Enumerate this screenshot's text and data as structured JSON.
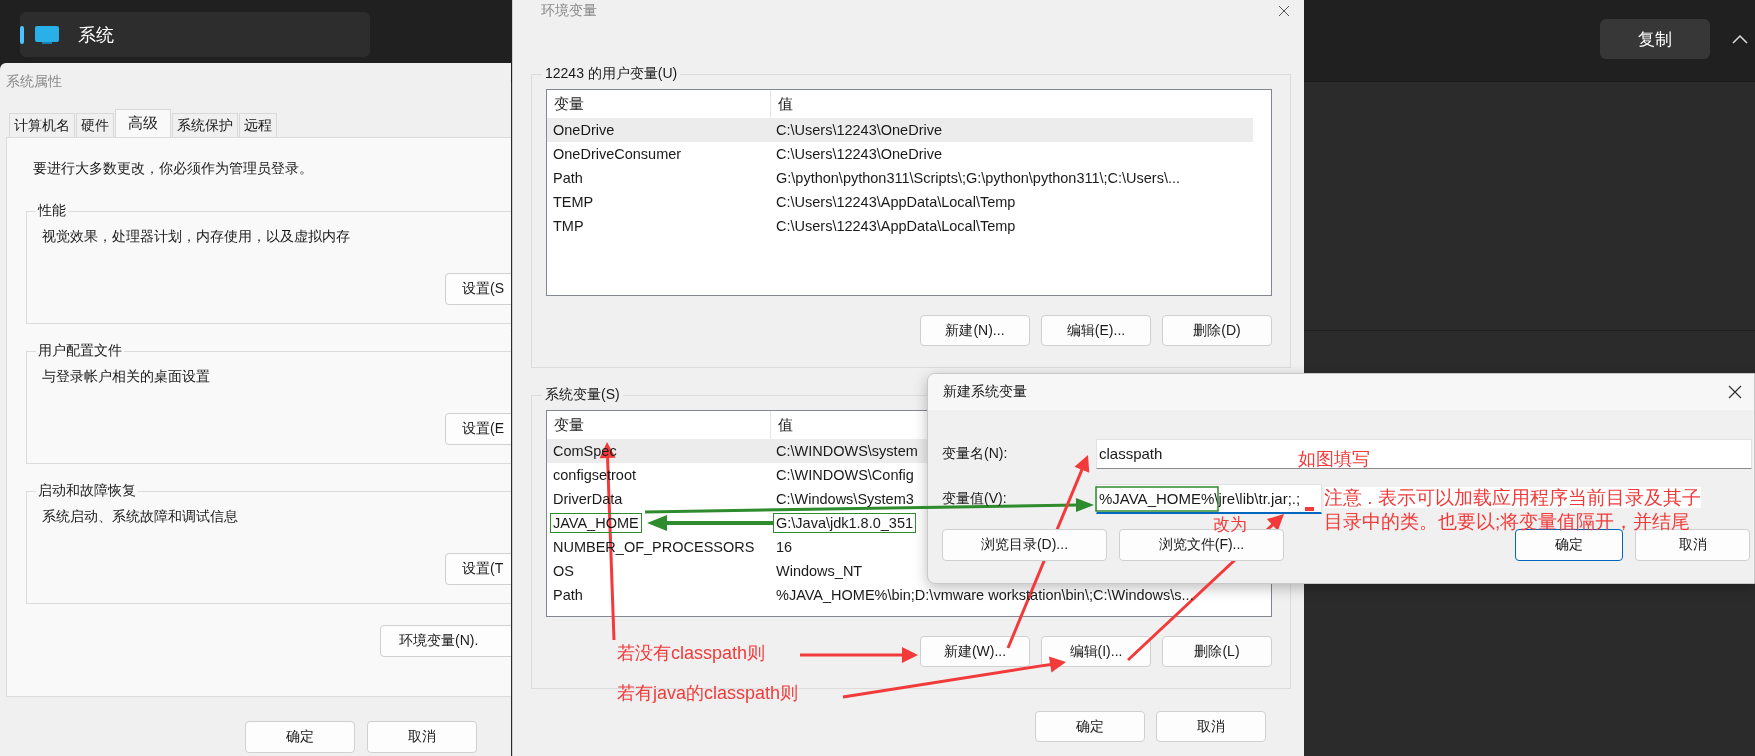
{
  "background_app": {
    "title": "系统",
    "copy_button": "复制"
  },
  "system_properties": {
    "title": "系统属性",
    "tabs": [
      {
        "label": "计算机名",
        "selected": false
      },
      {
        "label": "硬件",
        "selected": false
      },
      {
        "label": "高级",
        "selected": true
      },
      {
        "label": "系统保护",
        "selected": false
      },
      {
        "label": "远程",
        "selected": false
      }
    ],
    "notice": "要进行大多数更改，你必须作为管理员登录。",
    "groups": [
      {
        "title": "性能",
        "description": "视觉效果，处理器计划，内存使用，以及虚拟内存",
        "button": "设置(S"
      },
      {
        "title": "用户配置文件",
        "description": "与登录帐户相关的桌面设置",
        "button": "设置(E"
      },
      {
        "title": "启动和故障恢复",
        "description": "系统启动、系统故障和调试信息",
        "button": "设置(T"
      }
    ],
    "env_button": "环境变量(N).",
    "buttons": [
      "确定",
      "取消"
    ]
  },
  "env_vars": {
    "title": "环境变量",
    "user_group": {
      "title": "12243 的用户变量(U)",
      "columns": [
        "变量",
        "值"
      ],
      "rows": [
        {
          "name": "OneDrive",
          "value": "C:\\Users\\12243\\OneDrive",
          "selected": true
        },
        {
          "name": "OneDriveConsumer",
          "value": "C:\\Users\\12243\\OneDrive",
          "selected": false
        },
        {
          "name": "Path",
          "value": "G:\\python\\python311\\Scripts\\;G:\\python\\python311\\;C:\\Users\\...",
          "selected": false
        },
        {
          "name": "TEMP",
          "value": "C:\\Users\\12243\\AppData\\Local\\Temp",
          "selected": false
        },
        {
          "name": "TMP",
          "value": "C:\\Users\\12243\\AppData\\Local\\Temp",
          "selected": false
        }
      ],
      "buttons": [
        "新建(N)...",
        "编辑(E)...",
        "删除(D)"
      ]
    },
    "system_group": {
      "title": "系统变量(S)",
      "columns": [
        "变量",
        "值"
      ],
      "rows": [
        {
          "name": "ComSpec",
          "value": "C:\\WINDOWS\\system",
          "selected": true,
          "highlighted": false
        },
        {
          "name": "configsetroot",
          "value": "C:\\WINDOWS\\Config",
          "selected": false,
          "highlighted": false
        },
        {
          "name": "DriverData",
          "value": "C:\\Windows\\System3",
          "selected": false,
          "highlighted": false
        },
        {
          "name": "JAVA_HOME",
          "value": "G:\\Java\\jdk1.8.0_351",
          "selected": false,
          "highlighted": true
        },
        {
          "name": "NUMBER_OF_PROCESSORS",
          "value": "16",
          "selected": false,
          "highlighted": false
        },
        {
          "name": "OS",
          "value": "Windows_NT",
          "selected": false,
          "highlighted": false
        },
        {
          "name": "Path",
          "value": "%JAVA_HOME%\\bin;D:\\vmware workstation\\bin\\;C:\\Windows\\s...",
          "selected": false,
          "highlighted": false
        }
      ],
      "buttons": [
        "新建(W)...",
        "编辑(I)...",
        "删除(L)"
      ]
    },
    "buttons": [
      "确定",
      "取消"
    ]
  },
  "new_var_dialog": {
    "title": "新建系统变量",
    "fields": [
      {
        "label": "变量名(N):",
        "value": "classpath",
        "focused": false
      },
      {
        "label": "变量值(V):",
        "value": "%JAVA_HOME%\\jre\\lib\\tr.jar;.;",
        "focused": true
      }
    ],
    "buttons": [
      {
        "label": "浏览目录(D)...",
        "primary": false
      },
      {
        "label": "浏览文件(F)...",
        "primary": false
      },
      {
        "label": "确定",
        "primary": true
      },
      {
        "label": "取消",
        "primary": false
      }
    ]
  },
  "annotations": [
    {
      "text": "如图填写"
    },
    {
      "text": "改为"
    },
    {
      "text": "注意 . 表示可以加载应用程序当前目录及其子目录中的类。也要以;将变量值隔开，并结尾"
    },
    {
      "text": "若没有classpath则"
    },
    {
      "text": "若有java的classpath则"
    }
  ]
}
